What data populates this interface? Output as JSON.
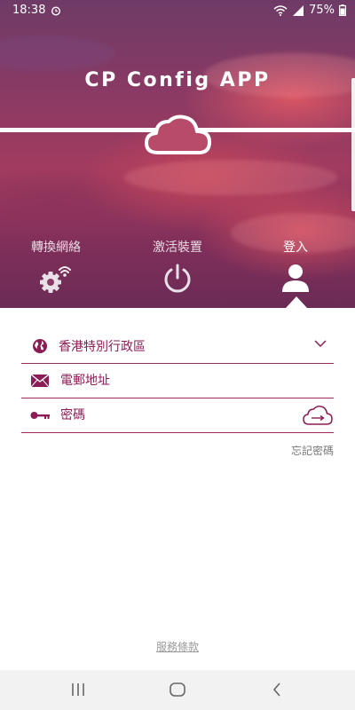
{
  "status_bar": {
    "time": "18:38",
    "battery": "75%"
  },
  "header": {
    "title": "CP Config APP"
  },
  "tabs": [
    {
      "label": "轉換網絡",
      "icon": "gear-wifi-icon",
      "active": false
    },
    {
      "label": "激活裝置",
      "icon": "power-icon",
      "active": false
    },
    {
      "label": "登入",
      "icon": "user-icon",
      "active": true
    }
  ],
  "form": {
    "region": {
      "value": "香港特別行政區",
      "icon": "globe-icon"
    },
    "email": {
      "placeholder": "電郵地址",
      "icon": "envelope-icon"
    },
    "password": {
      "placeholder": "密碼",
      "icon": "key-icon"
    }
  },
  "links": {
    "forgot_password": "忘記密碼",
    "terms": "服務條款"
  },
  "colors": {
    "accent": "#8a1d55",
    "line": "#9b2a63"
  }
}
